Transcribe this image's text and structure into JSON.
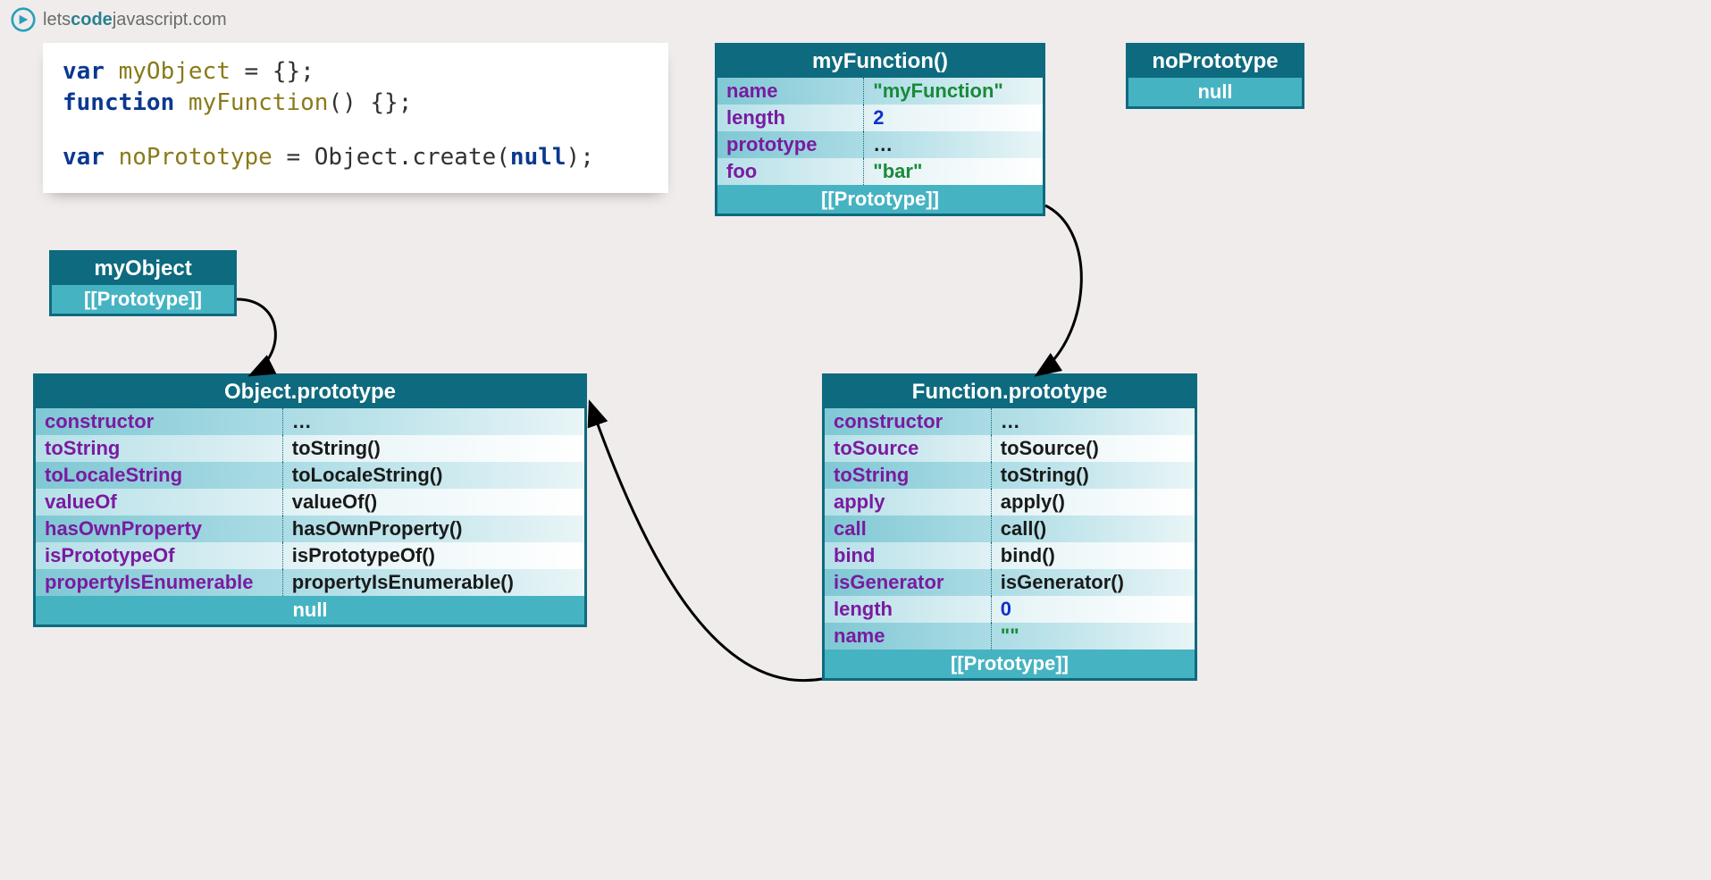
{
  "logo": {
    "text_prefix": "lets",
    "text_bold": "code",
    "text_suffix": "javascript.com"
  },
  "code": {
    "line1_kw1": "var",
    "line1_var": "myObject",
    "line1_rest": " = {};",
    "line2_kw1": "function",
    "line2_fn": "myFunction",
    "line2_rest": "() {};",
    "line3_kw1": "var",
    "line3_var": "noPrototype",
    "line3_rest1": " = Object.create(",
    "line3_null": "null",
    "line3_rest2": ");"
  },
  "boxes": {
    "myObject": {
      "title": "myObject",
      "proto": "[[Prototype]]"
    },
    "myFunction": {
      "title": "myFunction()",
      "props": [
        {
          "key": "name",
          "val": "\"myFunction\"",
          "type": "str"
        },
        {
          "key": "length",
          "val": "2",
          "type": "num"
        },
        {
          "key": "prototype",
          "val": "…",
          "type": "obj"
        },
        {
          "key": "foo",
          "val": "\"bar\"",
          "type": "str"
        }
      ],
      "proto": "[[Prototype]]"
    },
    "noPrototype": {
      "title": "noPrototype",
      "footer": "null"
    },
    "objectPrototype": {
      "title": "Object.prototype",
      "props": [
        {
          "key": "constructor",
          "val": "…"
        },
        {
          "key": "toString",
          "val": "toString()"
        },
        {
          "key": "toLocaleString",
          "val": "toLocaleString()"
        },
        {
          "key": "valueOf",
          "val": "valueOf()"
        },
        {
          "key": "hasOwnProperty",
          "val": "hasOwnProperty()"
        },
        {
          "key": "isPrototypeOf",
          "val": "isPrototypeOf()"
        },
        {
          "key": "propertyIsEnumerable",
          "val": "propertyIsEnumerable()"
        }
      ],
      "footer": "null"
    },
    "functionPrototype": {
      "title": "Function.prototype",
      "props": [
        {
          "key": "constructor",
          "val": "…"
        },
        {
          "key": "toSource",
          "val": "toSource()"
        },
        {
          "key": "toString",
          "val": "toString()"
        },
        {
          "key": "apply",
          "val": "apply()"
        },
        {
          "key": "call",
          "val": "call()"
        },
        {
          "key": "bind",
          "val": "bind()"
        },
        {
          "key": "isGenerator",
          "val": "isGenerator()"
        },
        {
          "key": "length",
          "val": "0",
          "type": "num"
        },
        {
          "key": "name",
          "val": "\"\"",
          "type": "str"
        }
      ],
      "proto": "[[Prototype]]"
    }
  }
}
